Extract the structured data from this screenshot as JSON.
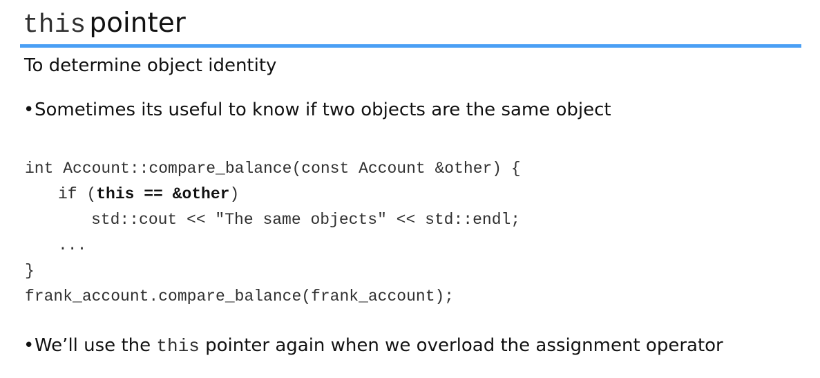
{
  "slide": {
    "title": {
      "code_word": "this",
      "word": "pointer"
    },
    "subtitle": "To determine object identity",
    "bullets": [
      {
        "text": "Sometimes its useful to know if two objects are the same object"
      },
      {
        "before": "We’ll use the ",
        "code": "this",
        "after": " pointer again when we overload the assignment operator"
      }
    ],
    "bullet_symbol": "•",
    "code_block": {
      "line1": "int Account::compare_balance(const Account &other) {",
      "line2_prefix": "if (",
      "line2_bold": "this == &other",
      "line2_suffix": ")",
      "line3": "std::cout << \"The same objects\" << std::endl;",
      "line4": "...",
      "line5": "}",
      "line6": "frank_account.compare_balance(frank_account);"
    },
    "colors": {
      "rule": "#4a9ff5",
      "text": "#111111",
      "code_text": "#303030"
    }
  }
}
